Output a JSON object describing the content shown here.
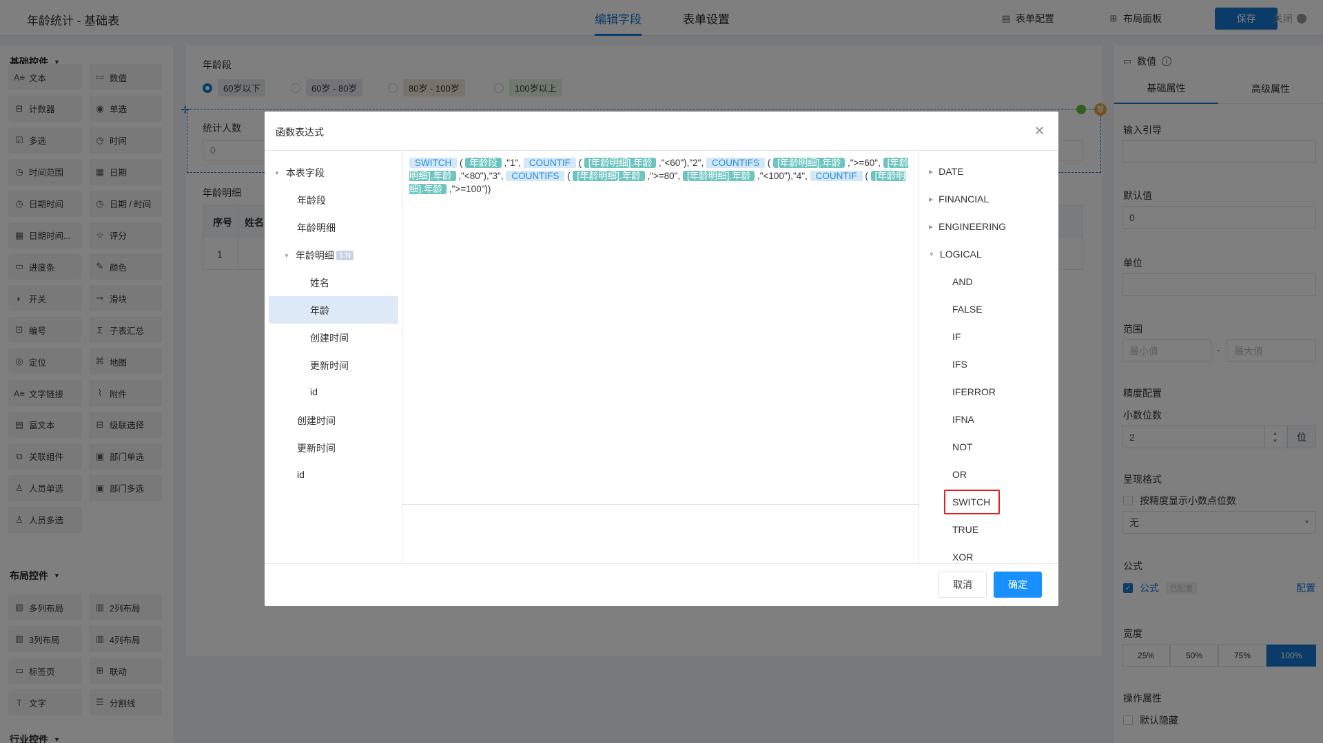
{
  "header": {
    "title": "年龄统计 - 基础表",
    "tabs": [
      {
        "label": "编辑字段",
        "active": true
      },
      {
        "label": "表单设置",
        "active": false
      }
    ],
    "form_config": "表单配置",
    "layout_panel": "布局面板",
    "save": "保存",
    "close": "关闭"
  },
  "sidebar": {
    "basic_title": "基础控件",
    "basic_items": [
      {
        "label": "文本",
        "icon": "text-icon"
      },
      {
        "label": "数值",
        "icon": "number-icon"
      },
      {
        "label": "计数器",
        "icon": "counter-icon"
      },
      {
        "label": "单选",
        "icon": "radio-icon"
      },
      {
        "label": "多选",
        "icon": "checkbox-icon"
      },
      {
        "label": "时间",
        "icon": "clock-icon"
      },
      {
        "label": "时间范围",
        "icon": "clock-icon"
      },
      {
        "label": "日期",
        "icon": "calendar-icon"
      },
      {
        "label": "日期时间",
        "icon": "clock-icon"
      },
      {
        "label": "日期 / 时间",
        "icon": "clock-icon"
      },
      {
        "label": "日期时间...",
        "icon": "calendar-icon"
      },
      {
        "label": "评分",
        "icon": "star-icon"
      },
      {
        "label": "进度条",
        "icon": "progress-icon"
      },
      {
        "label": "颜色",
        "icon": "dropper-icon"
      },
      {
        "label": "开关",
        "icon": "toggle-icon"
      },
      {
        "label": "滑块",
        "icon": "slider-icon"
      },
      {
        "label": "编号",
        "icon": "id-icon"
      },
      {
        "label": "子表汇总",
        "icon": "sigma-icon"
      },
      {
        "label": "定位",
        "icon": "location-icon"
      },
      {
        "label": "地图",
        "icon": "map-icon"
      },
      {
        "label": "文字链接",
        "icon": "link-text-icon"
      },
      {
        "label": "附件",
        "icon": "paperclip-icon"
      },
      {
        "label": "富文本",
        "icon": "richtext-icon"
      },
      {
        "label": "级联选择",
        "icon": "cascade-icon"
      },
      {
        "label": "关联组件",
        "icon": "relation-icon"
      },
      {
        "label": "部门单选",
        "icon": "department-icon"
      },
      {
        "label": "人员单选",
        "icon": "user-icon"
      },
      {
        "label": "部门多选",
        "icon": "department-icon"
      },
      {
        "label": "人员多选",
        "icon": "users-icon"
      }
    ],
    "layout_title": "布局控件",
    "layout_items": [
      {
        "label": "多列布局",
        "icon": "columns-icon"
      },
      {
        "label": "2列布局",
        "icon": "columns-icon"
      },
      {
        "label": "3列布局",
        "icon": "columns-icon"
      },
      {
        "label": "4列布局",
        "icon": "columns-icon"
      },
      {
        "label": "标签页",
        "icon": "tabs-icon"
      },
      {
        "label": "联动",
        "icon": "grid-icon"
      },
      {
        "label": "文字",
        "icon": "text-t-icon"
      },
      {
        "label": "分割线",
        "icon": "divider-icon"
      }
    ],
    "industry_title": "行业控件"
  },
  "canvas": {
    "age_group_label": "年龄段",
    "age_options": [
      {
        "label": "60岁以下",
        "checked": true,
        "color": "#e6e8eb"
      },
      {
        "label": "60岁 - 80岁",
        "checked": false,
        "color": "#e9e6f5"
      },
      {
        "label": "80岁 - 100岁",
        "checked": false,
        "color": "#f3e7dd"
      },
      {
        "label": "100岁以上",
        "checked": false,
        "color": "#e1f1e0"
      }
    ],
    "stats_label": "统计人数",
    "stats_value": "0",
    "detail_label": "年龄明细",
    "table_headers": [
      "序号",
      "姓名"
    ],
    "table_rows": [
      [
        "1",
        ""
      ]
    ]
  },
  "right_panel": {
    "field_type": "数值",
    "tabs": [
      "基础属性",
      "高级属性"
    ],
    "input_guide_label": "输入引导",
    "default_label": "默认值",
    "default_value": "0",
    "unit_label": "单位",
    "range_label": "范围",
    "range_min_placeholder": "最小值",
    "range_max_placeholder": "最大值",
    "precision_title": "精度配置",
    "decimals_label": "小数位数",
    "decimals_value": "2",
    "decimals_unit": "位",
    "format_label": "呈现格式",
    "show_decimals_label": "按精度显示小数点位数",
    "format_value": "无",
    "formula_title": "公式",
    "formula_checkbox": "公式",
    "formula_status": "已配置",
    "formula_config": "配置",
    "width_label": "宽度",
    "widths": [
      {
        "label": "25%"
      },
      {
        "label": "50%"
      },
      {
        "label": "75%"
      },
      {
        "label": "100%",
        "active": true
      }
    ],
    "ops_label": "操作属性",
    "hidden_label": "默认隐藏"
  },
  "modal": {
    "title": "函数表达式",
    "tree": {
      "root": "本表字段",
      "items": [
        {
          "label": "年龄段",
          "level": 1
        },
        {
          "label": "年龄明细",
          "level": 1
        },
        {
          "label": "年龄明细",
          "level": 1,
          "expanded": true,
          "badge": "1:N"
        },
        {
          "label": "姓名",
          "level": 2
        },
        {
          "label": "年龄",
          "level": 2,
          "selected": true
        },
        {
          "label": "创建时间",
          "level": 2
        },
        {
          "label": "更新时间",
          "level": 2
        },
        {
          "label": "id",
          "level": 2
        },
        {
          "label": "创建时间",
          "level": 1
        },
        {
          "label": "更新时间",
          "level": 1
        },
        {
          "label": "id",
          "level": 1
        }
      ]
    },
    "formula_tokens": [
      {
        "t": "fn",
        "v": "SWITCH"
      },
      {
        "t": "txt",
        "v": " ( "
      },
      {
        "t": "field",
        "v": "年龄段"
      },
      {
        "t": "txt",
        "v": " ,\"1\", "
      },
      {
        "t": "fn",
        "v": "COUNTIF"
      },
      {
        "t": "txt",
        "v": " ( "
      },
      {
        "t": "field",
        "v": "[年龄明细].年龄"
      },
      {
        "t": "txt",
        "v": " ,\"<60\"),\"2\", "
      },
      {
        "t": "fn",
        "v": "COUNTIFS"
      },
      {
        "t": "txt",
        "v": " ( "
      },
      {
        "t": "field",
        "v": "[年龄明细].年龄"
      },
      {
        "t": "txt",
        "v": " ,\">=60\", "
      },
      {
        "t": "field",
        "v": "[年龄明细].年龄"
      },
      {
        "t": "txt",
        "v": " ,\"<80\"),\"3\", "
      },
      {
        "t": "fn",
        "v": "COUNTIFS"
      },
      {
        "t": "txt",
        "v": " ( "
      },
      {
        "t": "field",
        "v": "[年龄明细].年龄"
      },
      {
        "t": "txt",
        "v": " ,\">=80\", "
      },
      {
        "t": "field",
        "v": "[年龄明细].年龄"
      },
      {
        "t": "txt",
        "v": " ,\"<100\"),\"4\", "
      },
      {
        "t": "fn",
        "v": "COUNTIF"
      },
      {
        "t": "txt",
        "v": " ( "
      },
      {
        "t": "field",
        "v": "[年龄明细].年龄"
      },
      {
        "t": "txt",
        "v": " ,\">=100\"))"
      }
    ],
    "functions": [
      {
        "label": "DATE",
        "group": true,
        "expanded": false
      },
      {
        "label": "FINANCIAL",
        "group": true,
        "expanded": false
      },
      {
        "label": "ENGINEERING",
        "group": true,
        "expanded": false
      },
      {
        "label": "LOGICAL",
        "group": true,
        "expanded": true
      },
      {
        "label": "AND"
      },
      {
        "label": "FALSE"
      },
      {
        "label": "IF"
      },
      {
        "label": "IFS"
      },
      {
        "label": "IFERROR"
      },
      {
        "label": "IFNA"
      },
      {
        "label": "NOT"
      },
      {
        "label": "OR"
      },
      {
        "label": "SWITCH",
        "highlighted": true
      },
      {
        "label": "TRUE"
      },
      {
        "label": "XOR"
      }
    ],
    "cancel": "取消",
    "confirm": "确定"
  }
}
